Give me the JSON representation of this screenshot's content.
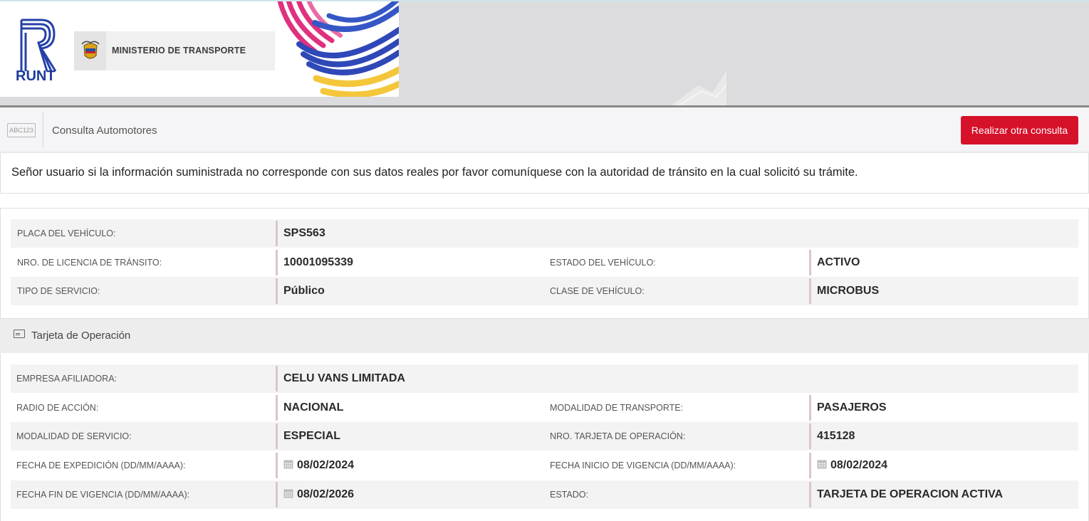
{
  "header": {
    "runt_text": "RUNT",
    "ministry_text": "MINISTERIO DE TRANSPORTE"
  },
  "toolbar": {
    "icon_text": "ABC123",
    "title": "Consulta Automotores",
    "button_label": "Realizar otra consulta"
  },
  "notice": {
    "text": "Señor usuario si la información suministrada no corresponde con sus datos reales por favor comuníquese con la autoridad de tránsito en la cual solicitó su trámite."
  },
  "vehicle": {
    "placa_label": "PLACA DEL VEHÍCULO:",
    "placa_value": "SPS563",
    "licencia_label": "NRO. DE LICENCIA DE TRÁNSITO:",
    "licencia_value": "10001095339",
    "estado_label": "ESTADO DEL VEHÍCULO:",
    "estado_value": "ACTIVO",
    "servicio_label": "TIPO DE SERVICIO:",
    "servicio_value": "Público",
    "clase_label": "CLASE DE VEHÍCULO:",
    "clase_value": "MICROBUS"
  },
  "tarjeta": {
    "section_title": "Tarjeta de Operación",
    "empresa_label": "EMPRESA AFILIADORA:",
    "empresa_value": "CELU VANS LIMITADA",
    "radio_label": "RADIO DE ACCIÓN:",
    "radio_value": "NACIONAL",
    "mod_transporte_label": "MODALIDAD DE TRANSPORTE:",
    "mod_transporte_value": "PASAJEROS",
    "mod_servicio_label": "MODALIDAD DE SERVICIO:",
    "mod_servicio_value": "ESPECIAL",
    "nro_tarjeta_label": "NRO. TARJETA DE OPERACIÓN:",
    "nro_tarjeta_value": "415128",
    "fecha_exp_label": "FECHA DE EXPEDICIÓN (DD/MM/AAAA):",
    "fecha_exp_value": "08/02/2024",
    "fecha_inicio_label": "FECHA INICIO DE VIGENCIA (DD/MM/AAAA):",
    "fecha_inicio_value": "08/02/2024",
    "fecha_fin_label": "FECHA FIN DE VIGENCIA (DD/MM/AAAA):",
    "fecha_fin_value": "08/02/2026",
    "estado_label": "ESTADO:",
    "estado_value": "TARJETA DE OPERACION ACTIVA"
  },
  "colors": {
    "accent_red": "#d6112a",
    "brand_blue": "#1e3b9a",
    "value_bar": "#dcc5c8"
  },
  "icons": [
    "runt-logo-icon",
    "colombia-crest-icon",
    "abc123-icon",
    "id-card-icon",
    "calendar-icon"
  ]
}
